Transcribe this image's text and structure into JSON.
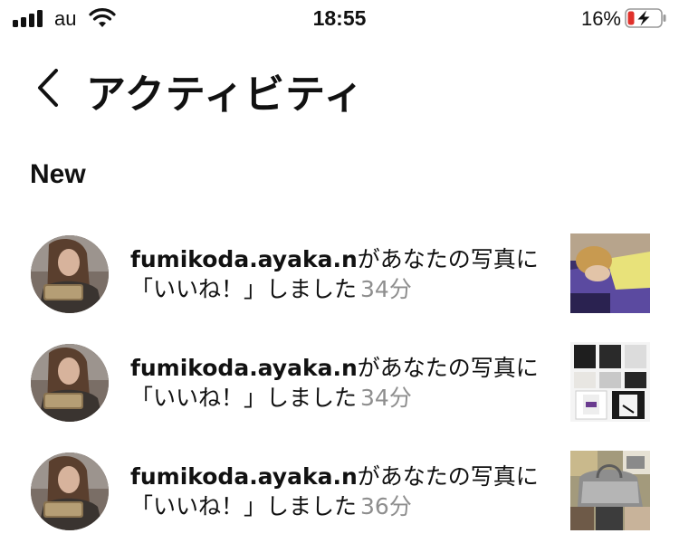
{
  "status_bar": {
    "carrier": "au",
    "time": "18:55",
    "battery_percent": "16%",
    "battery_level": 0.16,
    "charging": true,
    "signal_bars": 4,
    "icons": [
      "signal-icon",
      "wifi-icon",
      "battery-charging-icon"
    ]
  },
  "header": {
    "back_icon": "chevron-left-icon",
    "title": "アクティビティ"
  },
  "section": {
    "label": "New"
  },
  "activities": [
    {
      "username": "fumikoda.ayaka.n",
      "line1_suffix": "があなたの写真に",
      "line2": "「いいね！」しました",
      "time_ago": "34分",
      "thumb": "sleeping-person-photo"
    },
    {
      "username": "fumikoda.ayaka.n",
      "line1_suffix": "があなたの写真に",
      "line2": "「いいね！」しました",
      "time_ago": "34分",
      "thumb": "clothing-grid-photo"
    },
    {
      "username": "fumikoda.ayaka.n",
      "line1_suffix": "があなたの写真に",
      "line2": "「いいね！」しました",
      "time_ago": "36分",
      "thumb": "bag-collage-photo"
    }
  ],
  "colors": {
    "text": "#111111",
    "secondary_text": "#8e8e8e",
    "battery_low": "#e0312b",
    "background": "#ffffff"
  }
}
